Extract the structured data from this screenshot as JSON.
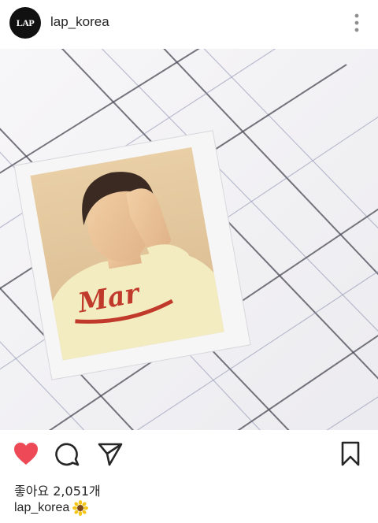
{
  "header": {
    "avatar_text": "LAP",
    "username": "lap_korea",
    "more_icon": "more-vertical-icon"
  },
  "post": {
    "photo_icon": "polaroid-photo",
    "shirt_text": "Mar"
  },
  "actions": {
    "like_icon": "heart-icon",
    "comment_icon": "comment-icon",
    "share_icon": "send-icon",
    "save_icon": "bookmark-icon",
    "liked": true,
    "like_color": "#ed4956"
  },
  "likes": {
    "text": "좋아요 2,051개"
  },
  "caption": {
    "username": "lap_korea",
    "emoji_icon": "sunflower-icon"
  }
}
